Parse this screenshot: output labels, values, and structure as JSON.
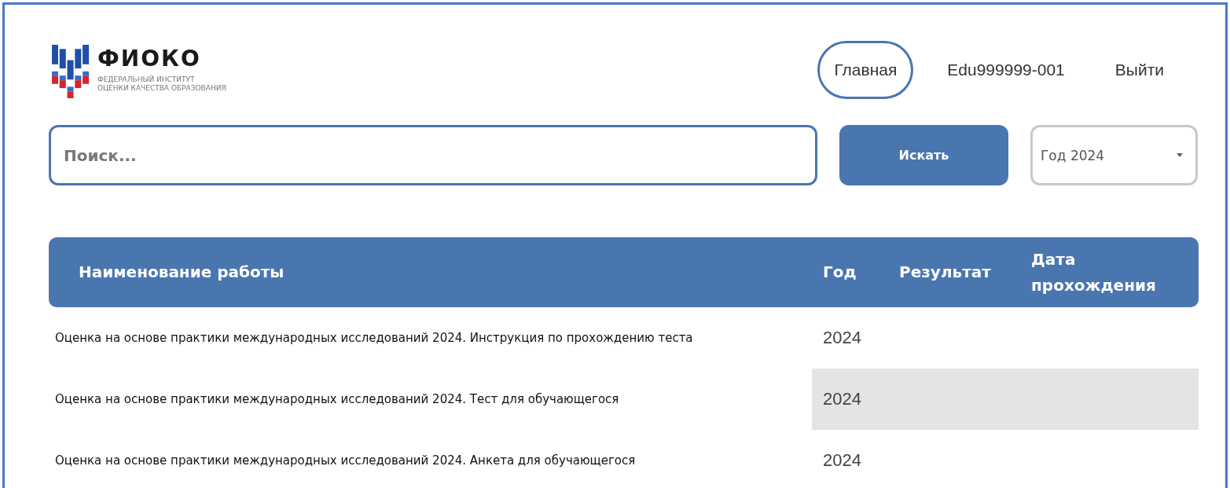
{
  "logo": {
    "title": "ФИОКО",
    "subtitle_lines": [
      "ФЕДЕРАЛЬНЫЙ ИНСТИТУТ",
      "ОЦЕНКИ КАЧЕСТВА ОБРАЗОВАНИЯ"
    ]
  },
  "nav": [
    {
      "label": "Главная",
      "selected": true
    },
    {
      "label": "Edu999999-001",
      "selected": false
    },
    {
      "label": "Выйти",
      "selected": false
    }
  ],
  "search": {
    "placeholder": "Поиск...",
    "button": "Искать",
    "year_select": "Год 2024"
  },
  "table": {
    "columns": [
      "Наименование работы",
      "Год",
      "Результат",
      "Дата прохождения"
    ],
    "rows": [
      {
        "cells": [
          "Оценка на основе практики международных исследований 2024. Инструкция по прохождению теста",
          "2024",
          "",
          ""
        ],
        "highlighted": false
      },
      {
        "cells": [
          "Оценка на основе практики международных исследований 2024. Тест для обучающегося",
          "2024",
          "",
          ""
        ],
        "highlighted": true
      },
      {
        "cells": [
          "Оценка на основе практики международных исследований 2024. Анкета для обучающегося",
          "2024",
          "",
          ""
        ],
        "highlighted": false
      }
    ]
  }
}
